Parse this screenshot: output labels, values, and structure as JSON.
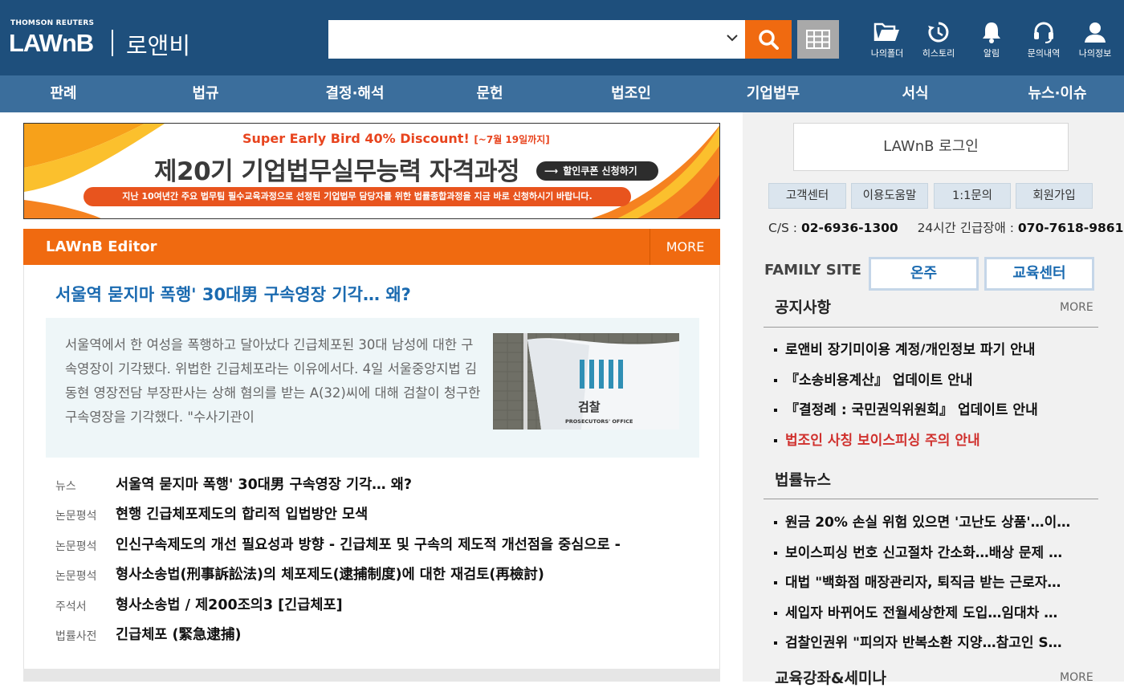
{
  "header": {
    "brand_small": "THOMSON REUTERS",
    "brand_logo": "LAWnB",
    "brand_kor": "로앤비",
    "search": {
      "value": "",
      "placeholder": ""
    },
    "icons": [
      {
        "label": "나의폴더",
        "icon": "folder-icon"
      },
      {
        "label": "히스토리",
        "icon": "history-icon"
      },
      {
        "label": "알림",
        "icon": "bell-icon"
      },
      {
        "label": "문의내역",
        "icon": "headset-icon"
      },
      {
        "label": "나의정보",
        "icon": "user-icon"
      }
    ]
  },
  "nav": [
    "판례",
    "법규",
    "결정·해석",
    "문헌",
    "법조인",
    "기업법무",
    "서식",
    "뉴스·이슈"
  ],
  "banner": {
    "tagline": "Super Early Bird 40% Discount!",
    "tagline_date": "[~7월 19일까지]",
    "title": "제20기 기업법무실무능력 자격과정",
    "cta": "할인쿠폰 신청하기",
    "subtitle": "지난 10여년간 주요 법무팀 필수교육과정으로 선정된 기업법무 담당자를 위한 법률종합과정을 지금 바로 신청하시기 바랍니다."
  },
  "editor": {
    "title": "LAWnB Editor",
    "more": "MORE",
    "headline": "서울역 묻지마 폭행' 30대男 구속영장 기각… 왜?",
    "summary": "서울역에서 한 여성을 폭행하고 달아났다 긴급체포된 30대 남성에 대한 구속영장이 기각됐다. 위법한 긴급체포라는 이유에서다. 4일 서울중앙지법 김동현 영장전담 부장판사는 상해 혐의를 받는 A(32)씨에 대해 검찰이 청구한 구속영장을 기각했다. \"수사기관이",
    "image_text": {
      "main": "검찰",
      "sub": "PROSECUTORS' OFFICE"
    },
    "related": [
      {
        "category": "뉴스",
        "title": "서울역 묻지마 폭행' 30대男 구속영장 기각… 왜?"
      },
      {
        "category": "논문평석",
        "title": "현행 긴급체포제도의 합리적 입법방안 모색"
      },
      {
        "category": "논문평석",
        "title": "인신구속제도의 개선 필요성과 방향 - 긴급체포 및 구속의 제도적 개선점을 중심으로 -"
      },
      {
        "category": "논문평석",
        "title": "형사소송법(刑事訴訟法)의 체포제도(逮捕制度)에 대한 재검토(再檢討)"
      },
      {
        "category": "주석서",
        "title": "형사소송법 / 제200조의3 [긴급체포]"
      },
      {
        "category": "법률사전",
        "title": "긴급체포 (緊急逮捕)"
      }
    ]
  },
  "sidebar": {
    "login": "LAWnB 로그인",
    "buttons": [
      "고객센터",
      "이용도움말",
      "1:1문의",
      "회원가입"
    ],
    "cs_label": "C/S : ",
    "cs_phone": "02-6936-1300",
    "emergency_label": "24시간 긴급장애 : ",
    "emergency_phone": "070-7618-9861",
    "family_label": "FAMILY SITE",
    "family_sites": [
      "온주",
      "교육센터"
    ],
    "notice": {
      "title": "공지사항",
      "more": "MORE",
      "items": [
        {
          "text": "로앤비 장기미이용 계정/개인정보 파기 안내",
          "highlight": false
        },
        {
          "text": "『소송비용계산』 업데이트 안내",
          "highlight": false
        },
        {
          "text": "『결정례 : 국민권익위원회』 업데이트 안내",
          "highlight": false
        },
        {
          "text": "법조인 사칭 보이스피싱 주의 안내",
          "highlight": true
        }
      ]
    },
    "news": {
      "title": "법률뉴스",
      "items": [
        "원금 20% 손실 위험 있으면 '고난도 상품'…이…",
        "보이스피싱 번호 신고절차 간소화…배상 문제 …",
        "대법 \"백화점 매장관리자, 퇴직금 받는 근로자…",
        "세입자 바뀌어도 전월세상한제 도입…임대차 …",
        "검찰인권위 \"피의자 반복소환 지양…참고인 S…"
      ]
    },
    "next_section": {
      "title": "교육강좌&세미나",
      "more": "MORE"
    }
  },
  "colors": {
    "header": "#1e4f7c",
    "nav": "#3b6e9c",
    "accent": "#f06a10",
    "link": "#1a6ab0",
    "alert": "#d0302d"
  }
}
